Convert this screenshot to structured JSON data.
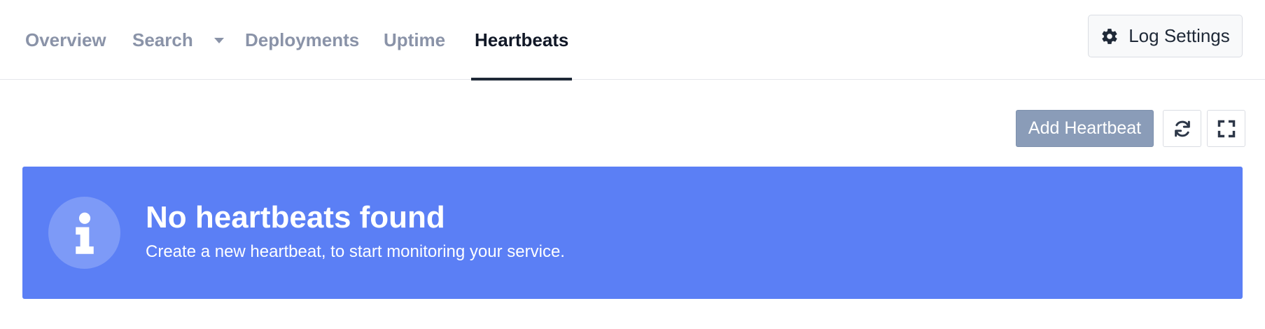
{
  "nav": {
    "tabs": [
      {
        "label": "Overview",
        "active": false
      },
      {
        "label": "Search",
        "active": false,
        "has_dropdown": true
      },
      {
        "label": "Deployments",
        "active": false
      },
      {
        "label": "Uptime",
        "active": false
      },
      {
        "label": "Heartbeats",
        "active": true
      }
    ],
    "log_settings_label": "Log Settings",
    "log_settings_icon": "gear-icon"
  },
  "toolbar": {
    "add_label": "Add Heartbeat",
    "refresh_icon": "refresh-icon",
    "fullscreen_icon": "fullscreen-icon"
  },
  "alert": {
    "icon": "info-icon",
    "title": "No heartbeats found",
    "text": "Create a new heartbeat, to start monitoring your service.",
    "color": "#5b7ff5"
  },
  "colors": {
    "active_tab": "#111827",
    "inactive_tab": "#8a93a8",
    "add_button": "#8a9cb8"
  }
}
